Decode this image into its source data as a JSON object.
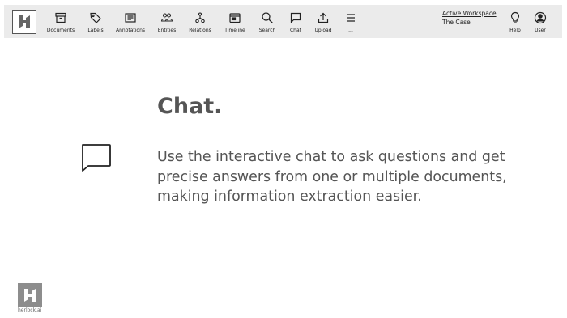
{
  "toolbar": {
    "items": [
      {
        "label": "Documents",
        "icon": "archive-box-icon"
      },
      {
        "label": "Labels",
        "icon": "tag-icon"
      },
      {
        "label": "Annotations",
        "icon": "note-lines-icon"
      },
      {
        "label": "Entities",
        "icon": "people-icon"
      },
      {
        "label": "Relations",
        "icon": "relations-graph-icon"
      },
      {
        "label": "Timeline",
        "icon": "calendar-timeline-icon"
      },
      {
        "label": "Search",
        "icon": "search-icon"
      },
      {
        "label": "Chat",
        "icon": "chat-bubble-icon"
      },
      {
        "label": "Upload",
        "icon": "upload-icon"
      },
      {
        "label": "...",
        "icon": "menu-icon"
      }
    ],
    "workspace": {
      "label": "Active Workspace",
      "name": "The Case"
    },
    "right_items": [
      {
        "label": "Help",
        "icon": "lightbulb-icon"
      },
      {
        "label": "User",
        "icon": "user-circle-icon"
      }
    ]
  },
  "hero": {
    "title": "Chat.",
    "description": "Use the interactive chat to ask questions and get precise answers from one or multiple documents, making information extraction easier.",
    "icon": "chat-bubble-icon"
  },
  "footer": {
    "brand": "herlock.ai"
  }
}
